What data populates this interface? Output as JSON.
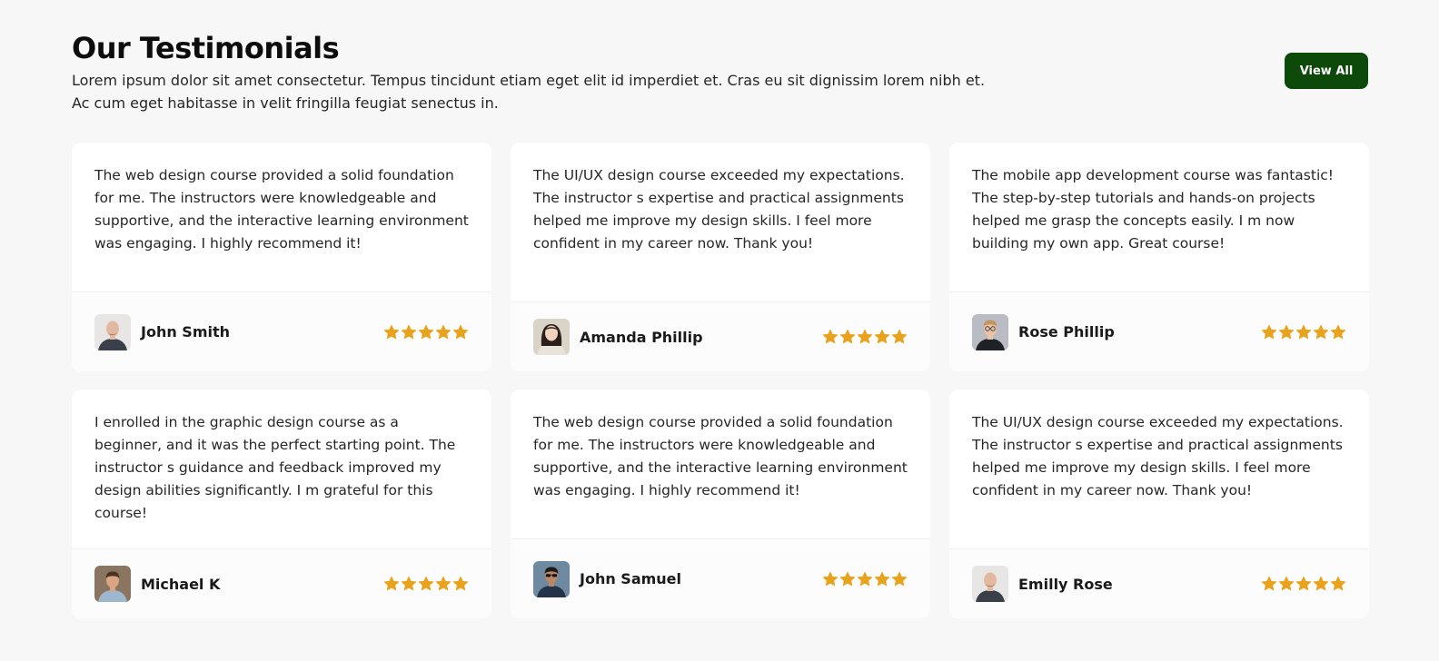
{
  "section": {
    "title": "Our Testimonials",
    "description": "Lorem ipsum dolor sit amet consectetur. Tempus tincidunt etiam eget elit id imperdiet et. Cras eu sit dignissim lorem nibh et. Ac cum eget habitasse in velit fringilla feugiat senectus in.",
    "view_all_label": "View All",
    "accent_color": "#0d4a0a",
    "star_color": "#e9a21b"
  },
  "testimonials": [
    {
      "quote": "The web design course provided a solid foundation for me. The instructors were knowledgeable and supportive, and the interactive learning environment was engaging. I highly recommend it!",
      "name": "John Smith",
      "rating": 5,
      "avatar": "bald-man-photo"
    },
    {
      "quote": "The UI/UX design course exceeded my expectations. The instructor s expertise and practical assignments helped me improve my design skills. I feel more confident in my career now. Thank you!",
      "name": "Amanda Phillip",
      "rating": 5,
      "avatar": "woman-photo"
    },
    {
      "quote": "The mobile app development course was fantastic! The step-by-step tutorials and hands-on projects helped me grasp the concepts easily. I m now building my own app. Great course!",
      "name": "Rose Phillip",
      "rating": 5,
      "avatar": "man-glasses-photo"
    },
    {
      "quote": "I enrolled in the graphic design course as a beginner, and it was the perfect starting point. The instructor s guidance and feedback improved my design abilities significantly. I m grateful for this course!",
      "name": "Michael K",
      "rating": 5,
      "avatar": "smiling-man-photo"
    },
    {
      "quote": "The web design course provided a solid foundation for me. The instructors were knowledgeable and supportive, and the interactive learning environment was engaging. I highly recommend it!",
      "name": "John Samuel",
      "rating": 5,
      "avatar": "man-sunglasses-photo"
    },
    {
      "quote": "The UI/UX design course exceeded my expectations. The instructor s expertise and practical assignments helped me improve my design skills. I feel more confident in my career now. Thank you!",
      "name": "Emilly Rose",
      "rating": 5,
      "avatar": "bald-man-photo"
    }
  ]
}
